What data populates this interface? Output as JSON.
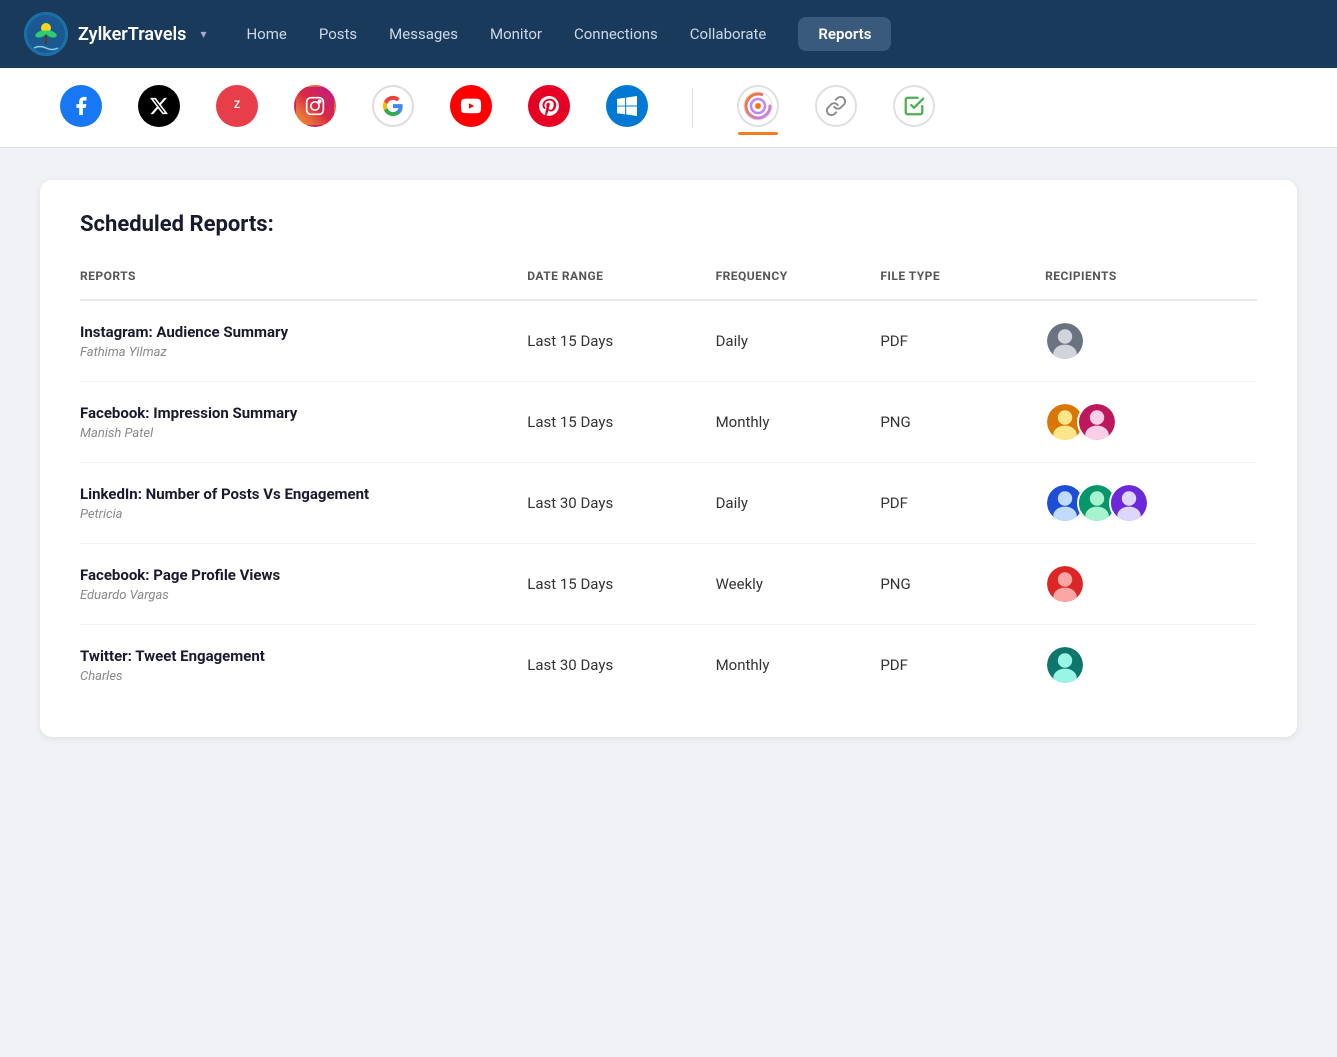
{
  "brand": {
    "logo_text": "Zylker\nTravels",
    "name": "ZylkerTravels",
    "chevron": "▾"
  },
  "nav": {
    "links": [
      {
        "label": "Home",
        "active": false
      },
      {
        "label": "Posts",
        "active": false
      },
      {
        "label": "Messages",
        "active": false
      },
      {
        "label": "Monitor",
        "active": false
      },
      {
        "label": "Connections",
        "active": false
      },
      {
        "label": "Collaborate",
        "active": false
      },
      {
        "label": "Reports",
        "active": true
      }
    ]
  },
  "social_bar": {
    "icons": [
      {
        "name": "facebook",
        "type": "facebook",
        "active": false
      },
      {
        "name": "twitter-x",
        "type": "twitter",
        "active": false
      },
      {
        "name": "zoho-desk",
        "type": "zoho",
        "active": false
      },
      {
        "name": "instagram",
        "type": "instagram",
        "active": false
      },
      {
        "name": "google",
        "type": "google",
        "active": false
      },
      {
        "name": "youtube",
        "type": "youtube",
        "active": false
      },
      {
        "name": "pinterest",
        "type": "pinterest",
        "active": false
      },
      {
        "name": "windows",
        "type": "windows",
        "active": false
      },
      {
        "name": "zcircle",
        "type": "zcircle",
        "active": true
      },
      {
        "name": "chain",
        "type": "chain",
        "active": false
      },
      {
        "name": "green-check",
        "type": "green",
        "active": false
      }
    ]
  },
  "page": {
    "title": "Scheduled Reports:"
  },
  "table": {
    "columns": [
      "REPORTS",
      "DATE RANGE",
      "FREQUENCY",
      "FILE TYPE",
      "RECIPIENTS"
    ],
    "rows": [
      {
        "report_name": "Instagram: Audience Summary",
        "owner": "Fathima Yilmaz",
        "date_range": "Last 15 Days",
        "frequency": "Daily",
        "file_type": "PDF",
        "recipient_count": 1,
        "recipient_colors": [
          "av1"
        ]
      },
      {
        "report_name": "Facebook: Impression Summary",
        "owner": "Manish Patel",
        "date_range": "Last 15 Days",
        "frequency": "Monthly",
        "file_type": "PNG",
        "recipient_count": 2,
        "recipient_colors": [
          "av2",
          "av3"
        ]
      },
      {
        "report_name": "LinkedIn: Number of Posts Vs Engagement",
        "owner": "Petricia",
        "date_range": "Last 30 Days",
        "frequency": "Daily",
        "file_type": "PDF",
        "recipient_count": 3,
        "recipient_colors": [
          "av4",
          "av5",
          "av6"
        ]
      },
      {
        "report_name": "Facebook: Page Profile Views",
        "owner": "Eduardo Vargas",
        "date_range": "Last 15 Days",
        "frequency": "Weekly",
        "file_type": "PNG",
        "recipient_count": 1,
        "recipient_colors": [
          "av7"
        ]
      },
      {
        "report_name": "Twitter: Tweet Engagement",
        "owner": "Charles",
        "date_range": "Last 30 Days",
        "frequency": "Monthly",
        "file_type": "PDF",
        "recipient_count": 1,
        "recipient_colors": [
          "av8"
        ]
      }
    ]
  }
}
